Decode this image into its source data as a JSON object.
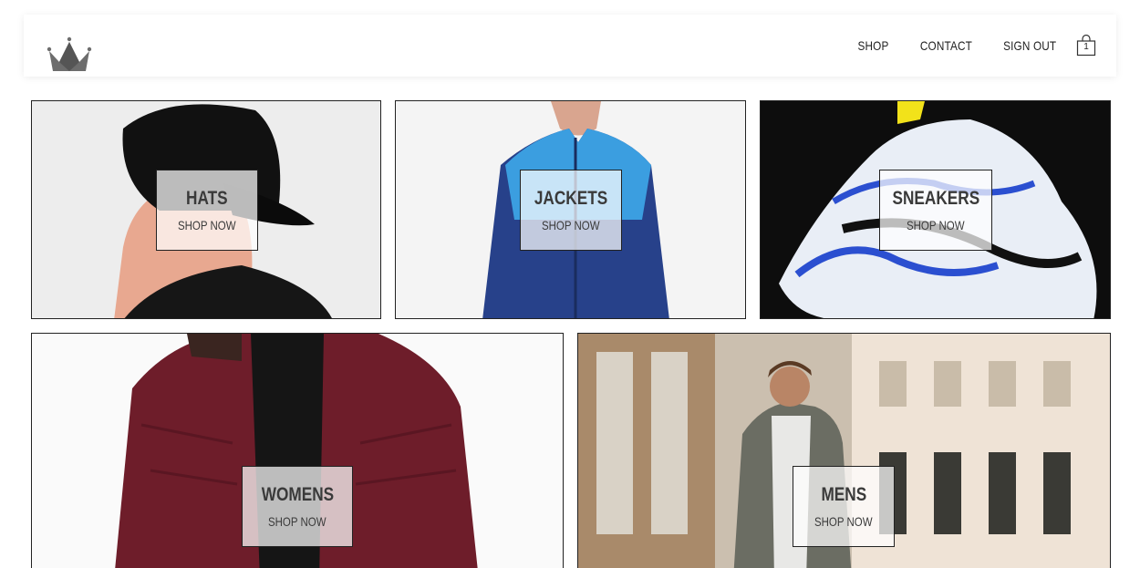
{
  "header": {
    "nav": [
      {
        "label": "SHOP"
      },
      {
        "label": "CONTACT"
      },
      {
        "label": "SIGN OUT"
      }
    ],
    "cart": {
      "icon": "shopping-bag-icon",
      "count": "1"
    },
    "logo_icon": "crown-icon"
  },
  "categories": [
    {
      "title": "HATS",
      "subtitle": "SHOP NOW"
    },
    {
      "title": "JACKETS",
      "subtitle": "SHOP NOW"
    },
    {
      "title": "SNEAKERS",
      "subtitle": "SHOP NOW"
    },
    {
      "title": "WOMENS",
      "subtitle": "SHOP NOW"
    },
    {
      "title": "MENS",
      "subtitle": "SHOP NOW"
    }
  ],
  "colors": {
    "border": "#222222",
    "label_bg": "rgba(255,255,255,0.72)",
    "text": "#3a3a3a"
  }
}
